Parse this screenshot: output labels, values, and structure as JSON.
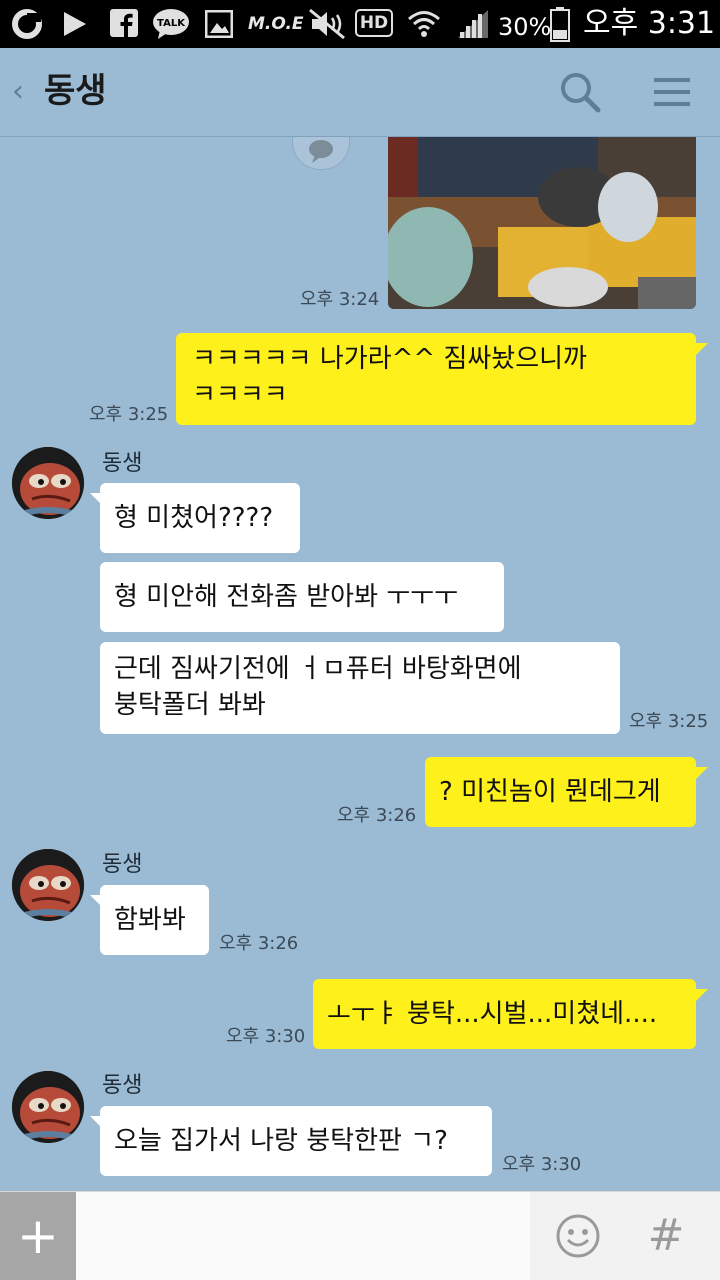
{
  "status_bar": {
    "battery": "30%",
    "time": "오후 3:31",
    "moe_label": "M.O.E",
    "hd_label": "HD",
    "talk_label": "TALK"
  },
  "header": {
    "title": "동생",
    "back_icon": "chevron-left-icon",
    "search_icon": "search-icon",
    "menu_icon": "hamburger-menu-icon"
  },
  "colors": {
    "background": "#9bbbd4",
    "my_bubble": "#fef01b",
    "other_bubble": "#ffffff"
  },
  "messages": {
    "photo_time": "오후 3:24",
    "m1_line1": "ㅋㅋㅋㅋㅋ 나가라^^ 짐싸놨으니까",
    "m1_line2": "ㅋㅋㅋㅋ",
    "m1_time": "오후 3:25",
    "sender1": "동생",
    "o1": "형 미쳤어????",
    "o2": "형 미안해 전화좀 받아봐 ㅜㅜㅜ",
    "o3_line1": "근데 짐싸기전에 ㅓㅁ퓨터 바탕화면에",
    "o3_line2": "붕탁폴더 봐봐",
    "o3_time": "오후 3:25",
    "m2": "? 미친놈이 뭔데그게",
    "m2_time": "오후 3:26",
    "sender2": "동생",
    "o4": "함봐봐",
    "o4_time": "오후 3:26",
    "m3": "ㅗㅜㅑ 붕탁...시벌...미쳤네....",
    "m3_time": "오후 3:30",
    "sender3": "동생",
    "o5": "오늘 집가서 나랑 붕탁한판 ㄱ?",
    "o5_time": "오후 3:30"
  },
  "input_bar": {
    "plus_label": "+",
    "hash_label": "#",
    "emoji_icon": "emoji-icon"
  }
}
